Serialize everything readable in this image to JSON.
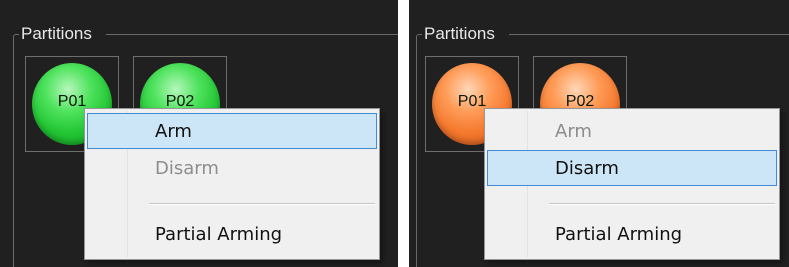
{
  "panels": [
    {
      "group_label": "Partitions",
      "partitions": [
        {
          "label": "P01",
          "color": "#22c534"
        },
        {
          "label": "P02",
          "color": "#22c534"
        }
      ],
      "menu": {
        "items": [
          {
            "label": "Arm",
            "enabled": true,
            "highlighted": true
          },
          {
            "label": "Disarm",
            "enabled": false,
            "highlighted": false
          },
          {
            "label": "Partial Arming",
            "enabled": true,
            "highlighted": false
          }
        ]
      }
    },
    {
      "group_label": "Partitions",
      "partitions": [
        {
          "label": "P01",
          "color": "#f4782d"
        },
        {
          "label": "P02",
          "color": "#f4782d"
        }
      ],
      "menu": {
        "items": [
          {
            "label": "Arm",
            "enabled": false,
            "highlighted": false
          },
          {
            "label": "Disarm",
            "enabled": true,
            "highlighted": true
          },
          {
            "label": "Partial Arming",
            "enabled": true,
            "highlighted": false
          }
        ]
      }
    }
  ]
}
